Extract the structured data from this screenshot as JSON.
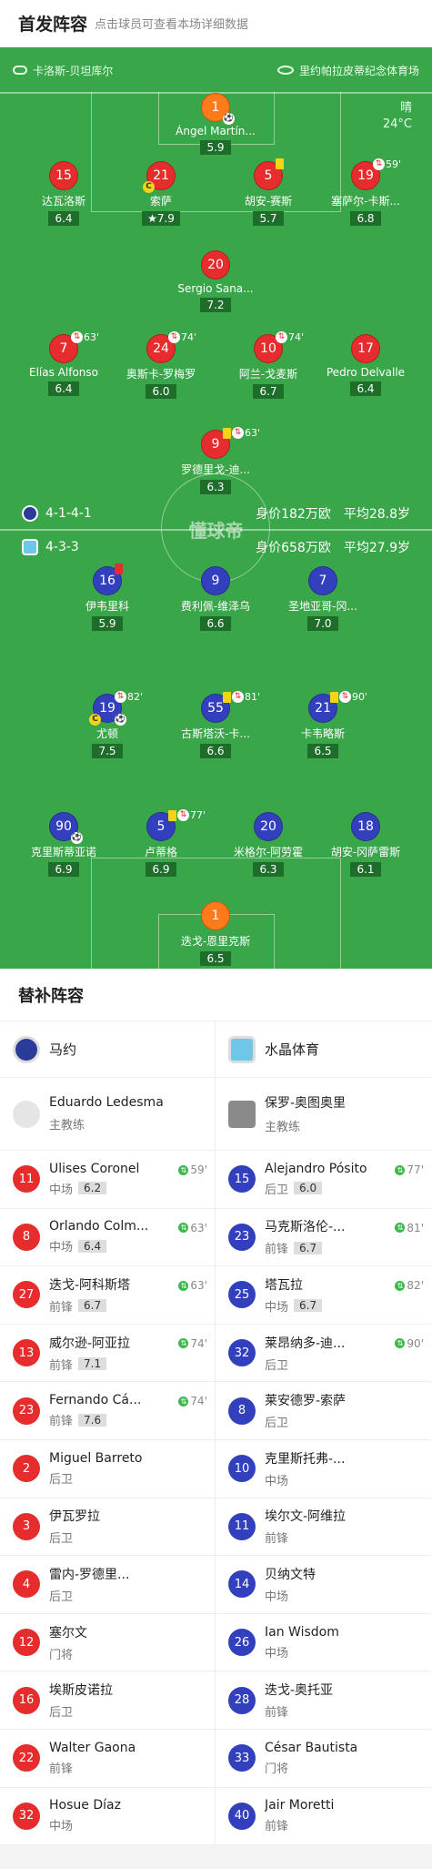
{
  "header": {
    "title": "首发阵容",
    "subtitle": "点击球员可查看本场详细数据"
  },
  "venue": {
    "referee": "卡洛斯-贝坦库尔",
    "stadium": "里约帕拉皮蒂纪念体育场"
  },
  "weather": {
    "condition": "晴",
    "temp": "24°C"
  },
  "logo_text": "懂球帝",
  "team_home": {
    "formation": "4-1-4-1",
    "value": "身价182万欧",
    "age": "平均28.8岁"
  },
  "team_away": {
    "formation": "4-3-3",
    "value": "身价658万欧",
    "age": "平均27.9岁"
  },
  "home_players": [
    {
      "num": "1",
      "name": "Ángel Martín...",
      "rating": "5.9",
      "color": "ora",
      "ball": "true"
    },
    {
      "num": "15",
      "name": "达瓦洛斯",
      "rating": "6.4",
      "color": "red"
    },
    {
      "num": "21",
      "name": "索萨",
      "rating": "★7.9",
      "color": "red",
      "cap": "true"
    },
    {
      "num": "5",
      "name": "胡安-赛斯",
      "rating": "5.7",
      "color": "red",
      "badge": "y"
    },
    {
      "num": "19",
      "name": "塞萨尔-卡斯...",
      "rating": "6.8",
      "color": "red",
      "badge": "s",
      "min": "59'"
    },
    {
      "num": "20",
      "name": "Sergio Sana...",
      "rating": "7.2",
      "color": "red"
    },
    {
      "num": "7",
      "name": "Elías Alfonso",
      "rating": "6.4",
      "color": "red",
      "badge": "s",
      "min": "63'"
    },
    {
      "num": "24",
      "name": "奥斯卡-罗梅罗",
      "rating": "6.0",
      "color": "red",
      "badge": "s",
      "min": "74'"
    },
    {
      "num": "10",
      "name": "阿兰-戈麦斯",
      "rating": "6.7",
      "color": "red",
      "badge": "s",
      "min": "74'"
    },
    {
      "num": "17",
      "name": "Pedro Delvalle",
      "rating": "6.4",
      "color": "red"
    },
    {
      "num": "9",
      "name": "罗德里戈-迪...",
      "rating": "6.3",
      "color": "red",
      "badge": "ys",
      "min": "63'"
    }
  ],
  "away_players": [
    {
      "num": "16",
      "name": "伊韦里科",
      "rating": "5.9",
      "color": "blu",
      "badge": "r"
    },
    {
      "num": "9",
      "name": "费利佩-维泽乌",
      "rating": "6.6",
      "color": "blu"
    },
    {
      "num": "7",
      "name": "圣地亚哥-冈...",
      "rating": "7.0",
      "color": "blu"
    },
    {
      "num": "19",
      "name": "尤顿",
      "rating": "7.5",
      "color": "blu",
      "badge": "s",
      "min": "82'",
      "cap": "true",
      "ball": "true"
    },
    {
      "num": "55",
      "name": "古斯塔沃-卡...",
      "rating": "6.6",
      "color": "blu",
      "badge": "ys",
      "min": "81'"
    },
    {
      "num": "21",
      "name": "卡韦略斯",
      "rating": "6.5",
      "color": "blu",
      "badge": "ys",
      "min": "90'"
    },
    {
      "num": "90",
      "name": "克里斯蒂亚诺",
      "rating": "6.9",
      "color": "blu",
      "ball": "true"
    },
    {
      "num": "5",
      "name": "卢蒂格",
      "rating": "6.9",
      "color": "blu",
      "badge": "ys",
      "min": "77'"
    },
    {
      "num": "20",
      "name": "米格尔-阿劳霍",
      "rating": "6.3",
      "color": "blu"
    },
    {
      "num": "18",
      "name": "胡安-冈萨雷斯",
      "rating": "6.1",
      "color": "blu"
    },
    {
      "num": "1",
      "name": "迭戈-恩里克斯",
      "rating": "6.5",
      "color": "ora"
    }
  ],
  "subs_title": "替补阵容",
  "home_subs": {
    "team": "马约",
    "coach": {
      "name": "Eduardo Ledesma",
      "role": "主教练"
    },
    "players": [
      {
        "num": "11",
        "name": "Ulises Coronel",
        "pos": "中场",
        "rating": "6.2",
        "min": "59'"
      },
      {
        "num": "8",
        "name": "Orlando Colm...",
        "pos": "中场",
        "rating": "6.4",
        "min": "63'"
      },
      {
        "num": "27",
        "name": "迭戈-阿科斯塔",
        "pos": "前锋",
        "rating": "6.7",
        "min": "63'"
      },
      {
        "num": "13",
        "name": "威尔逊-阿亚拉",
        "pos": "前锋",
        "rating": "7.1",
        "min": "74'"
      },
      {
        "num": "23",
        "name": "Fernando Cá...",
        "pos": "前锋",
        "rating": "7.6",
        "min": "74'"
      },
      {
        "num": "2",
        "name": "Miguel Barreto",
        "pos": "后卫",
        "rating": "",
        "min": ""
      },
      {
        "num": "3",
        "name": "伊瓦罗拉",
        "pos": "后卫",
        "rating": "",
        "min": ""
      },
      {
        "num": "4",
        "name": "雷内-罗德里...",
        "pos": "后卫",
        "rating": "",
        "min": ""
      },
      {
        "num": "12",
        "name": "塞尔文",
        "pos": "门将",
        "rating": "",
        "min": ""
      },
      {
        "num": "16",
        "name": "埃斯皮诺拉",
        "pos": "后卫",
        "rating": "",
        "min": ""
      },
      {
        "num": "22",
        "name": "Walter Gaona",
        "pos": "前锋",
        "rating": "",
        "min": ""
      },
      {
        "num": "32",
        "name": "Hosue Díaz",
        "pos": "中场",
        "rating": "",
        "min": ""
      }
    ]
  },
  "away_subs": {
    "team": "水晶体育",
    "coach": {
      "name": "保罗-奥图奥里",
      "role": "主教练"
    },
    "players": [
      {
        "num": "15",
        "name": "Alejandro Pósito",
        "pos": "后卫",
        "rating": "6.0",
        "min": "77'"
      },
      {
        "num": "23",
        "name": "马克斯洛伦-...",
        "pos": "前锋",
        "rating": "6.7",
        "min": "81'"
      },
      {
        "num": "25",
        "name": "塔瓦拉",
        "pos": "中场",
        "rating": "6.7",
        "min": "82'"
      },
      {
        "num": "32",
        "name": "莱昂纳多-迪...",
        "pos": "后卫",
        "rating": "",
        "min": "90'"
      },
      {
        "num": "8",
        "name": "莱安德罗-索萨",
        "pos": "后卫",
        "rating": "",
        "min": ""
      },
      {
        "num": "10",
        "name": "克里斯托弗-...",
        "pos": "中场",
        "rating": "",
        "min": ""
      },
      {
        "num": "11",
        "name": "埃尔文-阿维拉",
        "pos": "前锋",
        "rating": "",
        "min": ""
      },
      {
        "num": "14",
        "name": "贝纳文特",
        "pos": "中场",
        "rating": "",
        "min": ""
      },
      {
        "num": "26",
        "name": "Ian Wisdom",
        "pos": "中场",
        "rating": "",
        "min": ""
      },
      {
        "num": "28",
        "name": "迭戈-奥托亚",
        "pos": "前锋",
        "rating": "",
        "min": ""
      },
      {
        "num": "33",
        "name": "César Bautista",
        "pos": "门将",
        "rating": "",
        "min": ""
      },
      {
        "num": "40",
        "name": "Jair Moretti",
        "pos": "前锋",
        "rating": "",
        "min": ""
      }
    ]
  }
}
